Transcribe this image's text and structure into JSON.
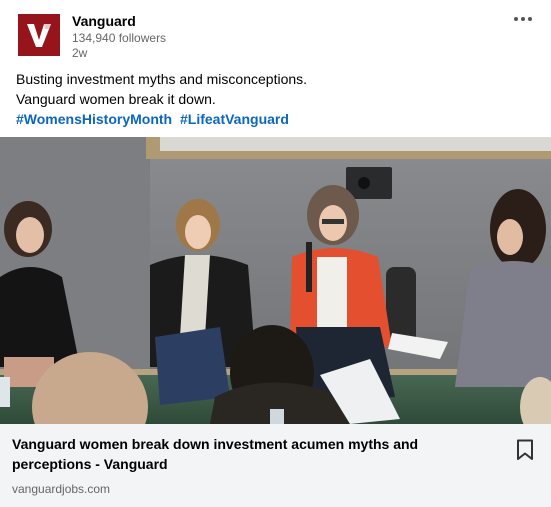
{
  "company": {
    "name": "Vanguard",
    "followers": "134,940 followers",
    "posted": "2w",
    "logo_letter": "V",
    "brand_color": "#96151d"
  },
  "post": {
    "lines": [
      "Busting investment myths and misconceptions.",
      "Vanguard women break it down."
    ],
    "hashtags": [
      "#WomensHistoryMonth",
      "#LifeatVanguard"
    ],
    "link_color": "#0a66c2"
  },
  "link_card": {
    "title": "Vanguard women break down investment acumen myths and perceptions - Vanguard",
    "domain": "vanguardjobs.com"
  },
  "icons": {
    "more": "more-horizontal-icon",
    "save": "bookmark-icon"
  }
}
